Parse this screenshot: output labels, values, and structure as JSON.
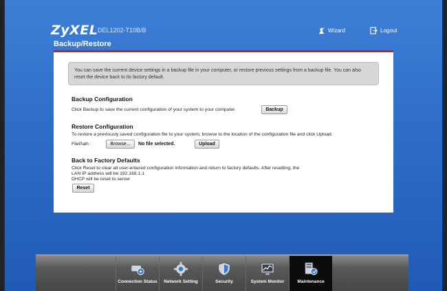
{
  "header": {
    "brand": "ZyXEL",
    "model": "DEL1202-T10B/B",
    "wizard_label": "Wizard",
    "logout_label": "Logout"
  },
  "page": {
    "title": "Backup/Restore",
    "notice": "You can save the current device settings in a backup file in your computer, or restore previous settings from a backup file. You can also reset the device back to its factory default."
  },
  "backup": {
    "title": "Backup Configuration",
    "text": "Click Backup to save the current configuration of your system to your computer.",
    "button": "Backup"
  },
  "restore": {
    "title": "Restore Configuration",
    "text": "To restore a previously saved configuration file to your system, browse to the location of the configuration file and click Upload.",
    "filepath_label": "FilePath :",
    "browse_button": "Browse...",
    "no_file": "No file selected.",
    "upload_button": "Upload"
  },
  "factory": {
    "title": "Back to Factory Defaults",
    "line1": "Click Reset to clear all user-entered configuration information and return to factory defaults. After resetting, the",
    "line2": "LAN IP address will be 192.168.1.1",
    "line3": "DHCP will be reset to server",
    "button": "Reset"
  },
  "nav": {
    "items": [
      {
        "label": "Connection Status",
        "icon": "connection-status-icon"
      },
      {
        "label": "Network Setting",
        "icon": "gear-icon"
      },
      {
        "label": "Security",
        "icon": "shield-icon"
      },
      {
        "label": "System Monitor",
        "icon": "monitor-chart-icon"
      },
      {
        "label": "Maintenance",
        "icon": "maintenance-icon",
        "active": true
      }
    ]
  },
  "colors": {
    "background_blue": "#2f6fca",
    "accent_red": "#d21c1c",
    "dock_gray": "#595959"
  }
}
